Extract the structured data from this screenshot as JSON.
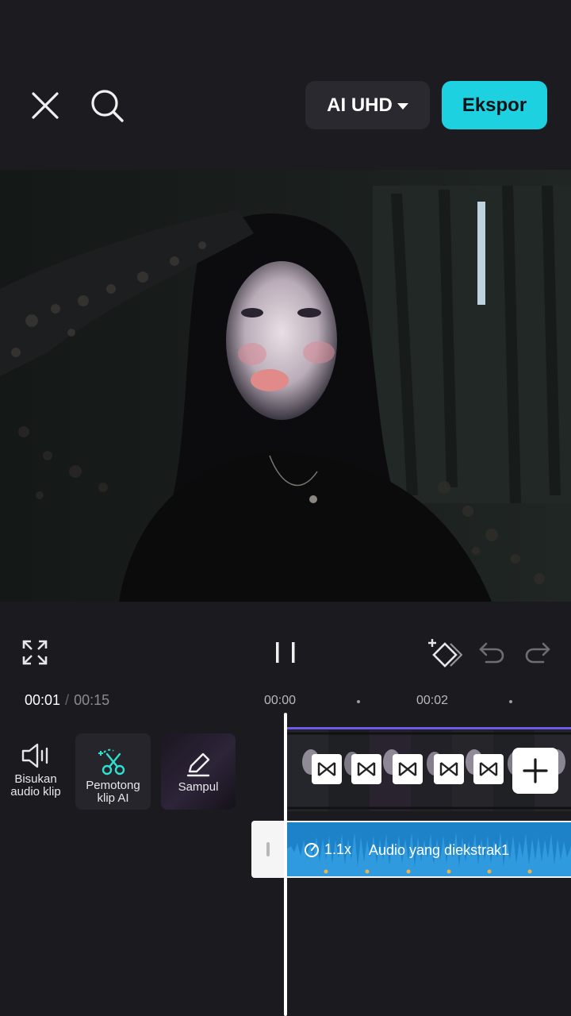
{
  "header": {
    "quality_label": "AI UHD",
    "export_label": "Ekspor"
  },
  "colors": {
    "accent": "#1dd1e0",
    "audio_track": "#1e82c8",
    "track_border": "#6c5ce7",
    "background": "#1b1a1f"
  },
  "icons": {
    "close": "close-icon",
    "search": "search-icon",
    "fullscreen": "fullscreen-icon",
    "pause": "pause-icon",
    "keyframe": "keyframe-add-icon",
    "undo": "undo-icon",
    "redo": "redo-icon",
    "mute": "speaker-icon",
    "cutter": "ai-scissors-icon",
    "cover": "edit-pencil-icon"
  },
  "timeline": {
    "current_time": "00:01",
    "separator": "/",
    "total_time": "00:15",
    "ruler_labels": [
      "00:00",
      "00:02"
    ],
    "tools": {
      "mute_label": "Bisukan audio klip",
      "cutter_label": "Pemotong klip AI",
      "cover_label": "Sampul"
    },
    "audio": {
      "speed": "1.1x",
      "name": "Audio yang diekstrak1"
    }
  }
}
